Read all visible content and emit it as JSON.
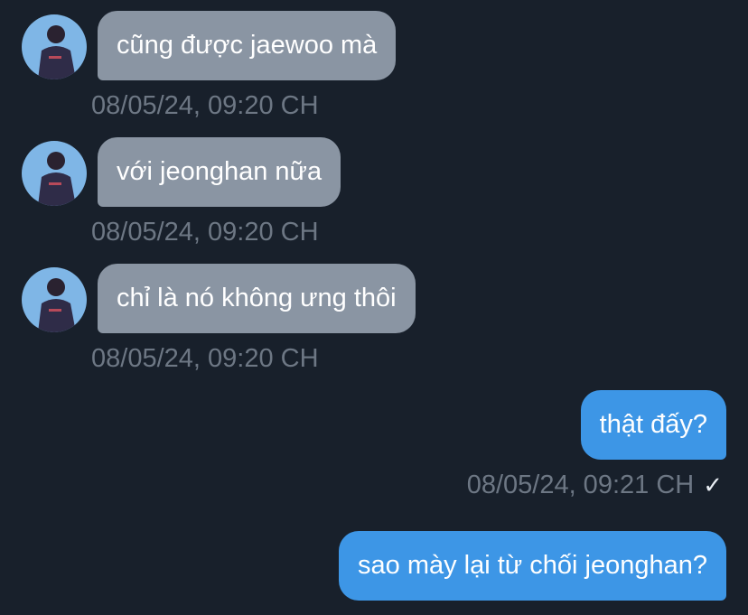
{
  "messages": [
    {
      "direction": "incoming",
      "text": "cũng được jaewoo mà",
      "timestamp": "08/05/24, 09:20 CH"
    },
    {
      "direction": "incoming",
      "text": "với jeonghan nữa",
      "timestamp": "08/05/24, 09:20 CH"
    },
    {
      "direction": "incoming",
      "text": "chỉ là nó không ưng thôi",
      "timestamp": "08/05/24, 09:20 CH"
    },
    {
      "direction": "outgoing",
      "text": "thật đấy?",
      "timestamp": "08/05/24, 09:21 CH",
      "status": "✓"
    },
    {
      "direction": "outgoing",
      "text": "sao mày lại từ chối jeonghan?"
    }
  ],
  "colors": {
    "background": "#18202b",
    "incoming_bubble": "#8a95a3",
    "outgoing_bubble": "#3d96e6",
    "timestamp": "#6d7784"
  },
  "icons": {
    "avatar": "contact-avatar",
    "read_receipt": "checkmark-icon"
  }
}
